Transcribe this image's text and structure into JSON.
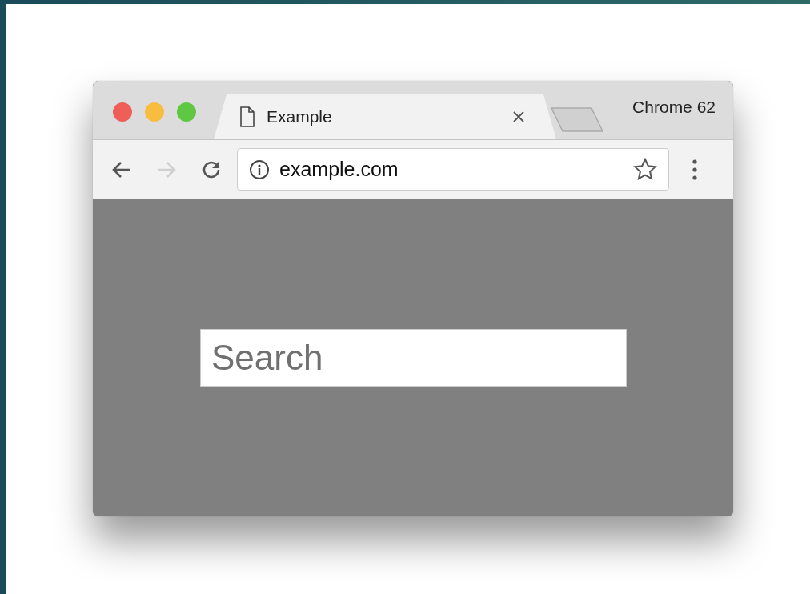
{
  "window": {
    "title": "Chrome 62"
  },
  "tabs": [
    {
      "label": "Example",
      "selected": true
    }
  ],
  "nav_buttons": [
    {
      "kind": "back",
      "disabled": false
    },
    {
      "kind": "forward",
      "disabled": true
    },
    {
      "kind": "reload",
      "disabled": false
    }
  ],
  "address_bar": {
    "value": "example.com"
  },
  "search": {
    "placeholder": "Search"
  }
}
